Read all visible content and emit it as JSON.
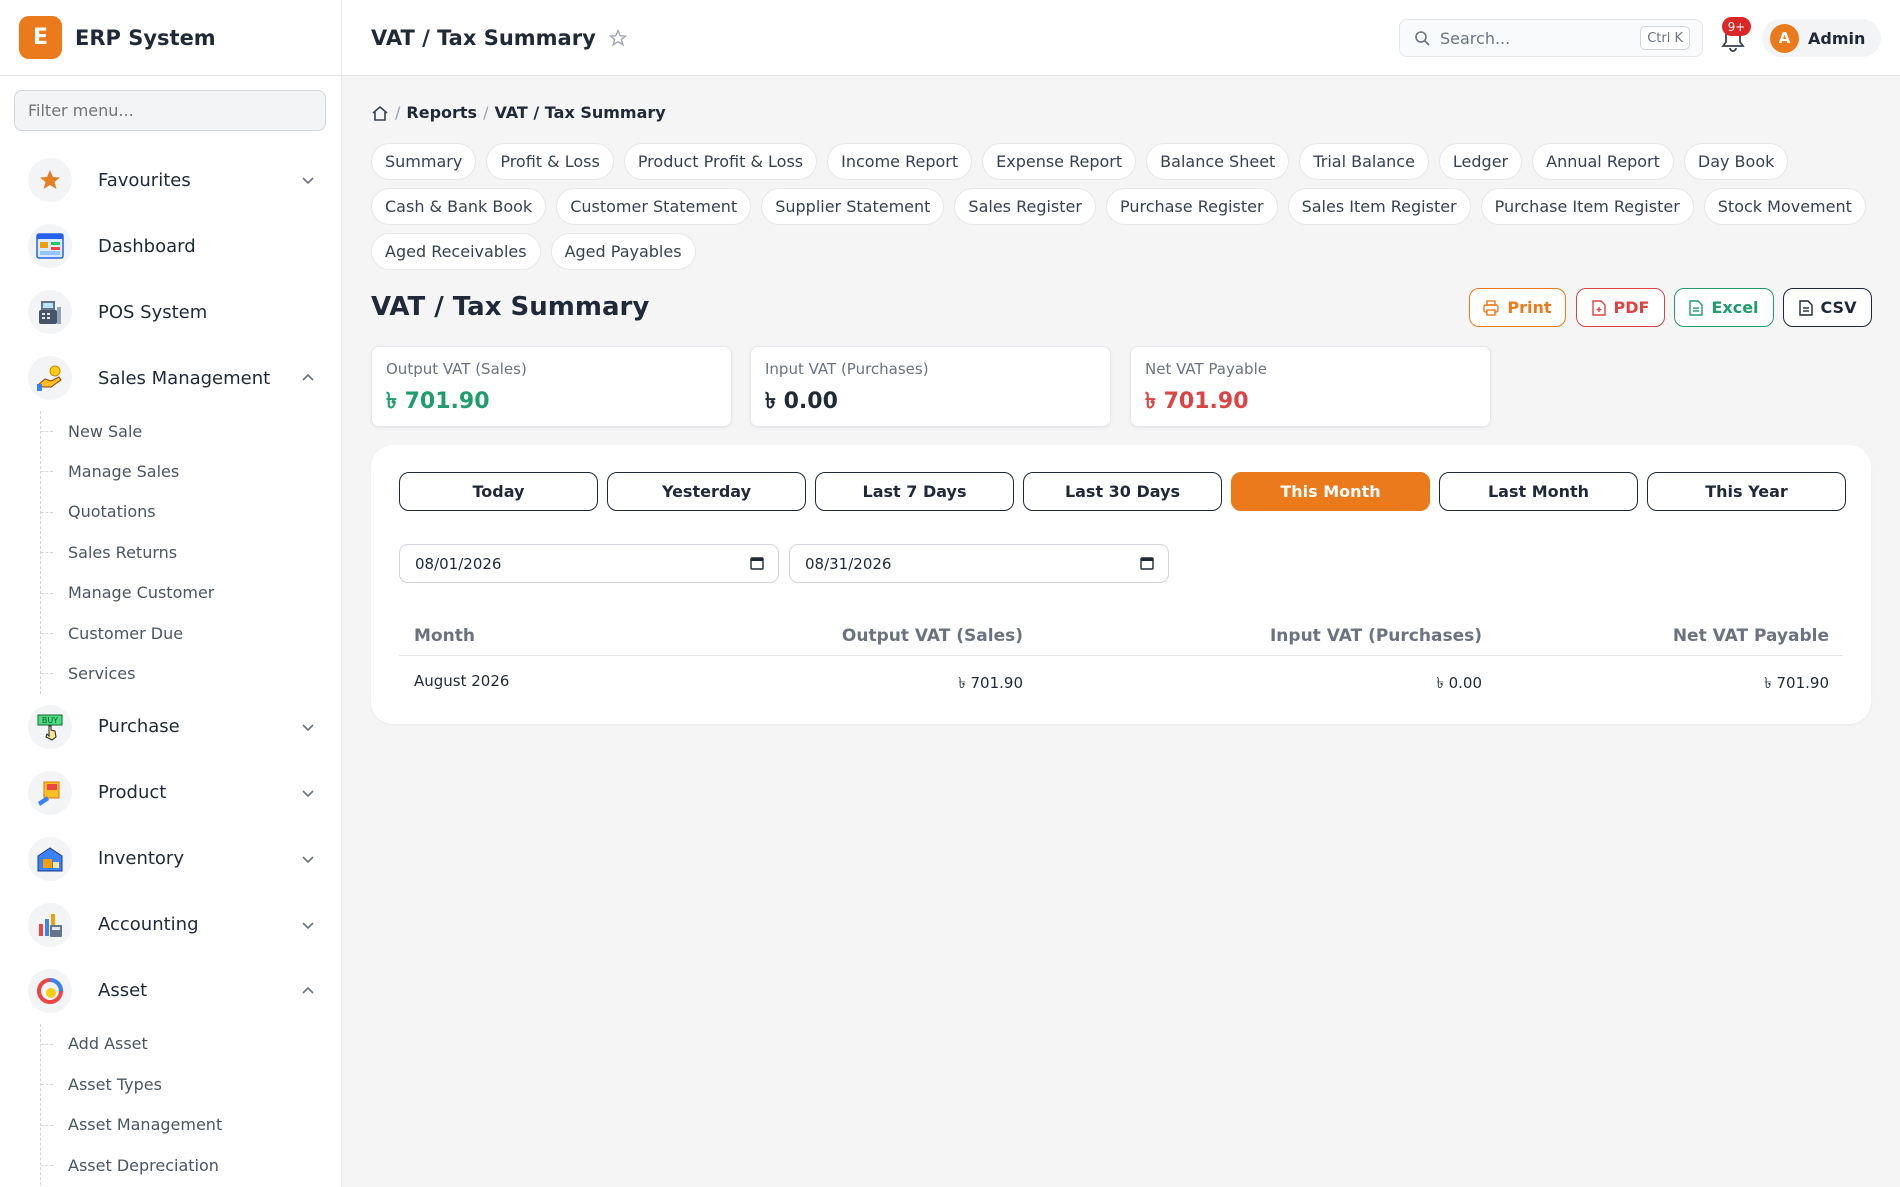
{
  "brand": {
    "logo_letter": "E",
    "name": "ERP System"
  },
  "sidebar": {
    "filter_placeholder": "Filter menu...",
    "items": [
      {
        "label": "Favourites",
        "icon": "star-icon",
        "expanded": false
      },
      {
        "label": "Dashboard",
        "icon": "dashboard-icon"
      },
      {
        "label": "POS System",
        "icon": "pos-icon"
      },
      {
        "label": "Sales Management",
        "icon": "sales-icon",
        "expanded": true,
        "children": [
          "New Sale",
          "Manage Sales",
          "Quotations",
          "Sales Returns",
          "Manage Customer",
          "Customer Due",
          "Services"
        ]
      },
      {
        "label": "Purchase",
        "icon": "buy-icon",
        "expanded": false
      },
      {
        "label": "Product",
        "icon": "product-icon",
        "expanded": false
      },
      {
        "label": "Inventory",
        "icon": "inventory-icon",
        "expanded": false
      },
      {
        "label": "Accounting",
        "icon": "accounting-icon",
        "expanded": false
      },
      {
        "label": "Asset",
        "icon": "asset-icon",
        "expanded": true,
        "children": [
          "Add Asset",
          "Asset Types",
          "Asset Management",
          "Asset Depreciation"
        ]
      }
    ]
  },
  "topbar": {
    "title": "VAT / Tax Summary",
    "search_placeholder": "Search...",
    "search_shortcut": "Ctrl K",
    "notification_count": "9+",
    "user_initial": "A",
    "user_name": "Admin"
  },
  "breadcrumb": {
    "parent": "Reports",
    "current": "VAT / Tax Summary"
  },
  "report_tabs": [
    [
      "Summary",
      "Profit & Loss",
      "Product Profit & Loss",
      "Income Report",
      "Expense Report",
      "Balance Sheet",
      "Trial Balance",
      "Ledger",
      "Annual Report",
      "Day Book"
    ],
    [
      "Cash & Bank Book",
      "Customer Statement",
      "Supplier Statement",
      "Sales Register",
      "Purchase Register",
      "Sales Item Register",
      "Purchase Item Register",
      "Stock Movement"
    ],
    [
      "Aged Receivables",
      "Aged Payables"
    ]
  ],
  "page_title": "VAT / Tax Summary",
  "export": {
    "print": "Print",
    "pdf": "PDF",
    "excel": "Excel",
    "csv": "CSV"
  },
  "stats": [
    {
      "label": "Output VAT (Sales)",
      "value": "৳ 701.90",
      "color": "#1f9d6b"
    },
    {
      "label": "Input VAT (Purchases)",
      "value": "৳ 0.00",
      "color": "#1f2937"
    },
    {
      "label": "Net VAT Payable",
      "value": "৳ 701.90",
      "color": "#dc4444"
    }
  ],
  "ranges": {
    "options": [
      "Today",
      "Yesterday",
      "Last 7 Days",
      "Last 30 Days",
      "This Month",
      "Last Month",
      "This Year"
    ],
    "selected": "This Month"
  },
  "dates": {
    "from": "08/01/2026",
    "to": "08/31/2026"
  },
  "table": {
    "columns": [
      "Month",
      "Output VAT (Sales)",
      "Input VAT (Purchases)",
      "Net VAT Payable"
    ],
    "rows": [
      [
        "August 2026",
        "৳ 701.90",
        "৳ 0.00",
        "৳ 701.90"
      ]
    ]
  },
  "colors": {
    "accent": "#ea7a1c",
    "success": "#1f9d6b",
    "danger": "#dc4444"
  }
}
